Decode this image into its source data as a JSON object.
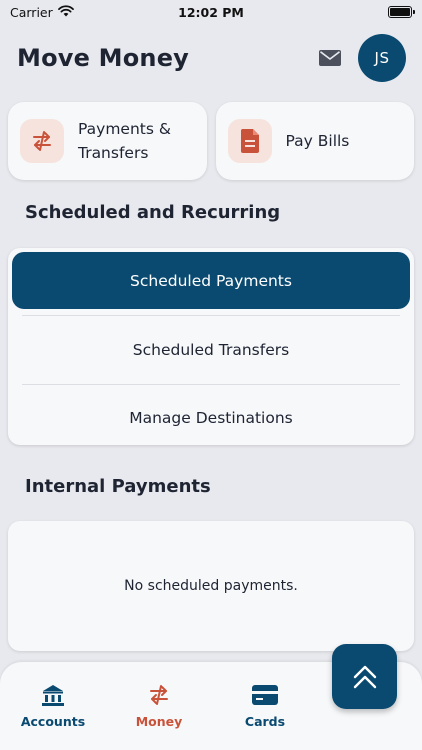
{
  "status_bar": {
    "carrier": "Carrier",
    "time": "12:02 PM"
  },
  "header": {
    "title": "Move Money",
    "avatar_initials": "JS"
  },
  "quick_actions": [
    {
      "label": "Payments & Transfers",
      "icon": "transfer-arrows-icon"
    },
    {
      "label": "Pay Bills",
      "icon": "bill-document-icon"
    }
  ],
  "scheduled": {
    "title": "Scheduled and Recurring",
    "items": [
      {
        "label": "Scheduled Payments",
        "active": true
      },
      {
        "label": "Scheduled Transfers",
        "active": false
      },
      {
        "label": "Manage Destinations",
        "active": false
      }
    ]
  },
  "internal": {
    "title": "Internal Payments",
    "empty_message": "No scheduled payments."
  },
  "bottom_nav": {
    "items": [
      {
        "label": "Accounts",
        "icon": "bank-icon",
        "active": false
      },
      {
        "label": "Money",
        "icon": "transfer-arrows-icon",
        "active": true
      },
      {
        "label": "Cards",
        "icon": "card-icon",
        "active": false
      }
    ]
  },
  "fab": {
    "icon": "double-chevron-up-icon"
  },
  "colors": {
    "primary": "#0a4a70",
    "accent": "#c9533a",
    "icon_bg": "#f6e3de",
    "background": "#e8e9ee",
    "card": "#f7f8fa"
  }
}
